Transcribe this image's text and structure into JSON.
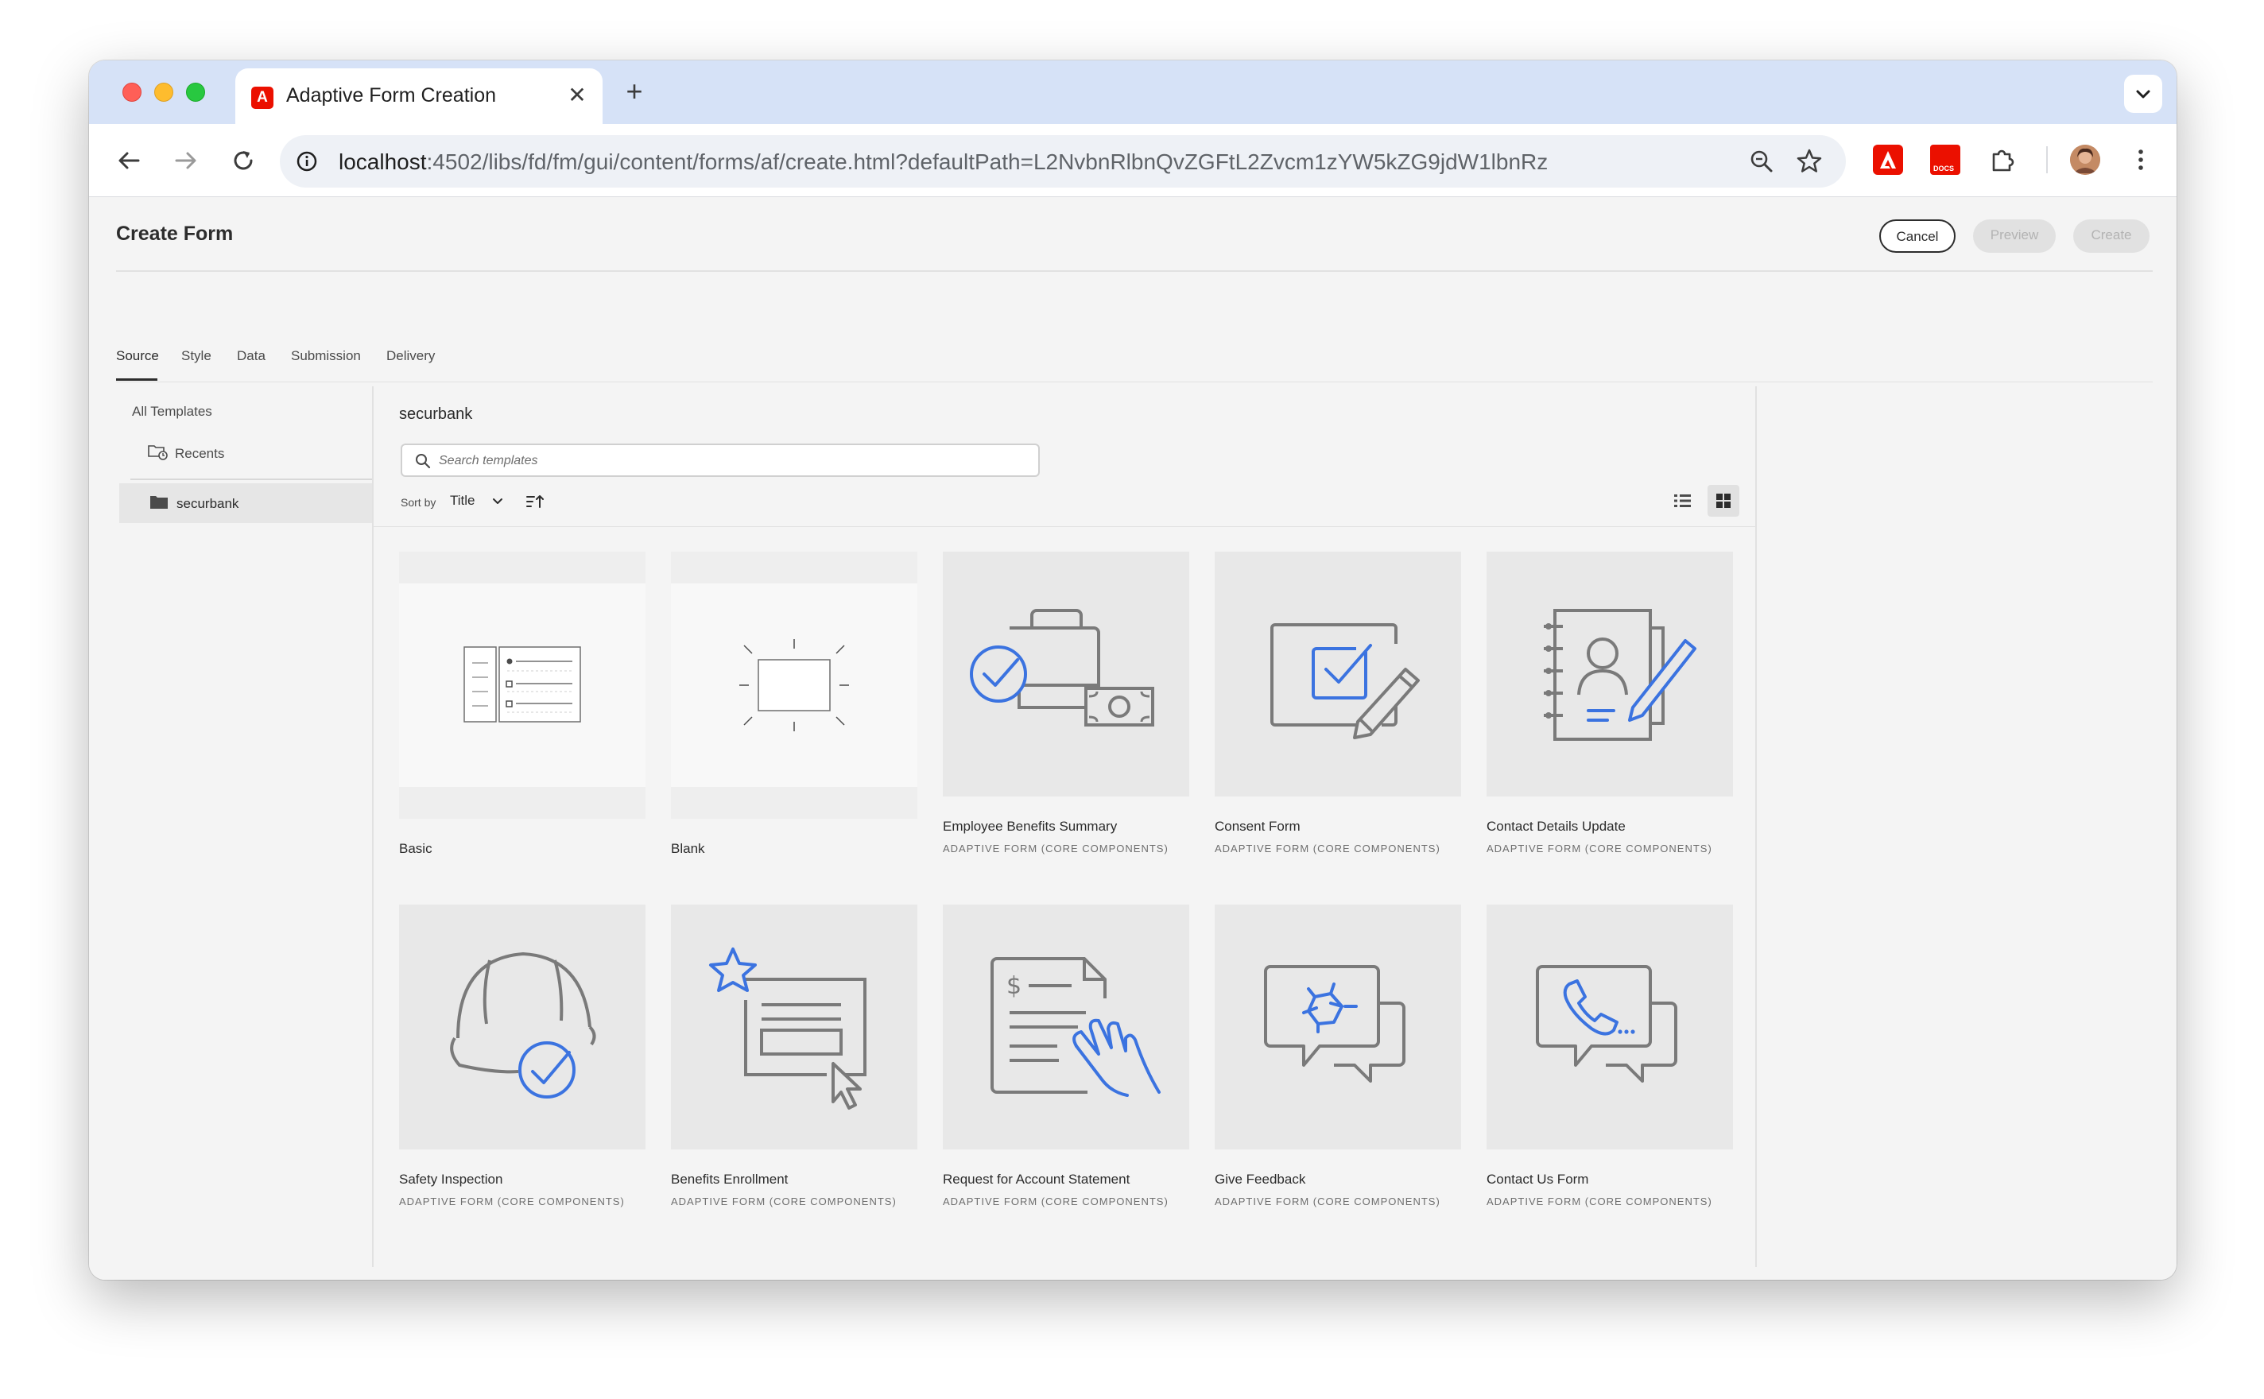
{
  "browser": {
    "tab_title": "Adaptive Form Creation",
    "url_host": "localhost",
    "url_rest": ":4502/libs/fd/fm/gui/content/forms/af/create.html?defaultPath=L2NvbnRlbnQvZGFtL2Zvcm1zYW5kZG9jdW1lbnRz",
    "extension_docs_label": "DOCS",
    "favicon_letter": "A"
  },
  "header": {
    "title": "Create Form",
    "cancel_label": "Cancel",
    "preview_label": "Preview",
    "create_label": "Create"
  },
  "tabs": [
    {
      "label": "Source",
      "selected": true
    },
    {
      "label": "Style",
      "selected": false
    },
    {
      "label": "Data",
      "selected": false
    },
    {
      "label": "Submission",
      "selected": false
    },
    {
      "label": "Delivery",
      "selected": false
    }
  ],
  "sidebar": {
    "all_templates": "All Templates",
    "recents": "Recents",
    "folder": "securbank"
  },
  "main": {
    "folder_title": "securbank",
    "search_placeholder": "Search templates",
    "sort_label": "Sort by",
    "sort_value": "Title"
  },
  "templates": [
    {
      "title": "Basic",
      "subtitle": "",
      "icon": "basic-form-icon"
    },
    {
      "title": "Blank",
      "subtitle": "",
      "icon": "blank-form-icon"
    },
    {
      "title": "Employee Benefits Summary",
      "subtitle": "ADAPTIVE FORM (CORE COMPONENTS)",
      "icon": "briefcase-check-icon"
    },
    {
      "title": "Consent Form",
      "subtitle": "ADAPTIVE FORM (CORE COMPONENTS)",
      "icon": "checkbox-pen-icon"
    },
    {
      "title": "Contact Details Update",
      "subtitle": "ADAPTIVE FORM (CORE COMPONENTS)",
      "icon": "address-book-pen-icon"
    },
    {
      "title": "Safety Inspection",
      "subtitle": "ADAPTIVE FORM (CORE COMPONENTS)",
      "icon": "hard-hat-check-icon"
    },
    {
      "title": "Benefits Enrollment",
      "subtitle": "ADAPTIVE FORM (CORE COMPONENTS)",
      "icon": "star-form-cursor-icon"
    },
    {
      "title": "Request for Account Statement",
      "subtitle": "ADAPTIVE FORM (CORE COMPONENTS)",
      "icon": "statement-hand-icon"
    },
    {
      "title": "Give Feedback",
      "subtitle": "ADAPTIVE FORM (CORE COMPONENTS)",
      "icon": "feedback-chat-icon"
    },
    {
      "title": "Contact Us Form",
      "subtitle": "ADAPTIVE FORM (CORE COMPONENTS)",
      "icon": "phone-chat-icon"
    }
  ],
  "colors": {
    "accent_blue": "#3b73e0",
    "icon_gray": "#7a7a7a",
    "adobe_red": "#eb1000"
  }
}
